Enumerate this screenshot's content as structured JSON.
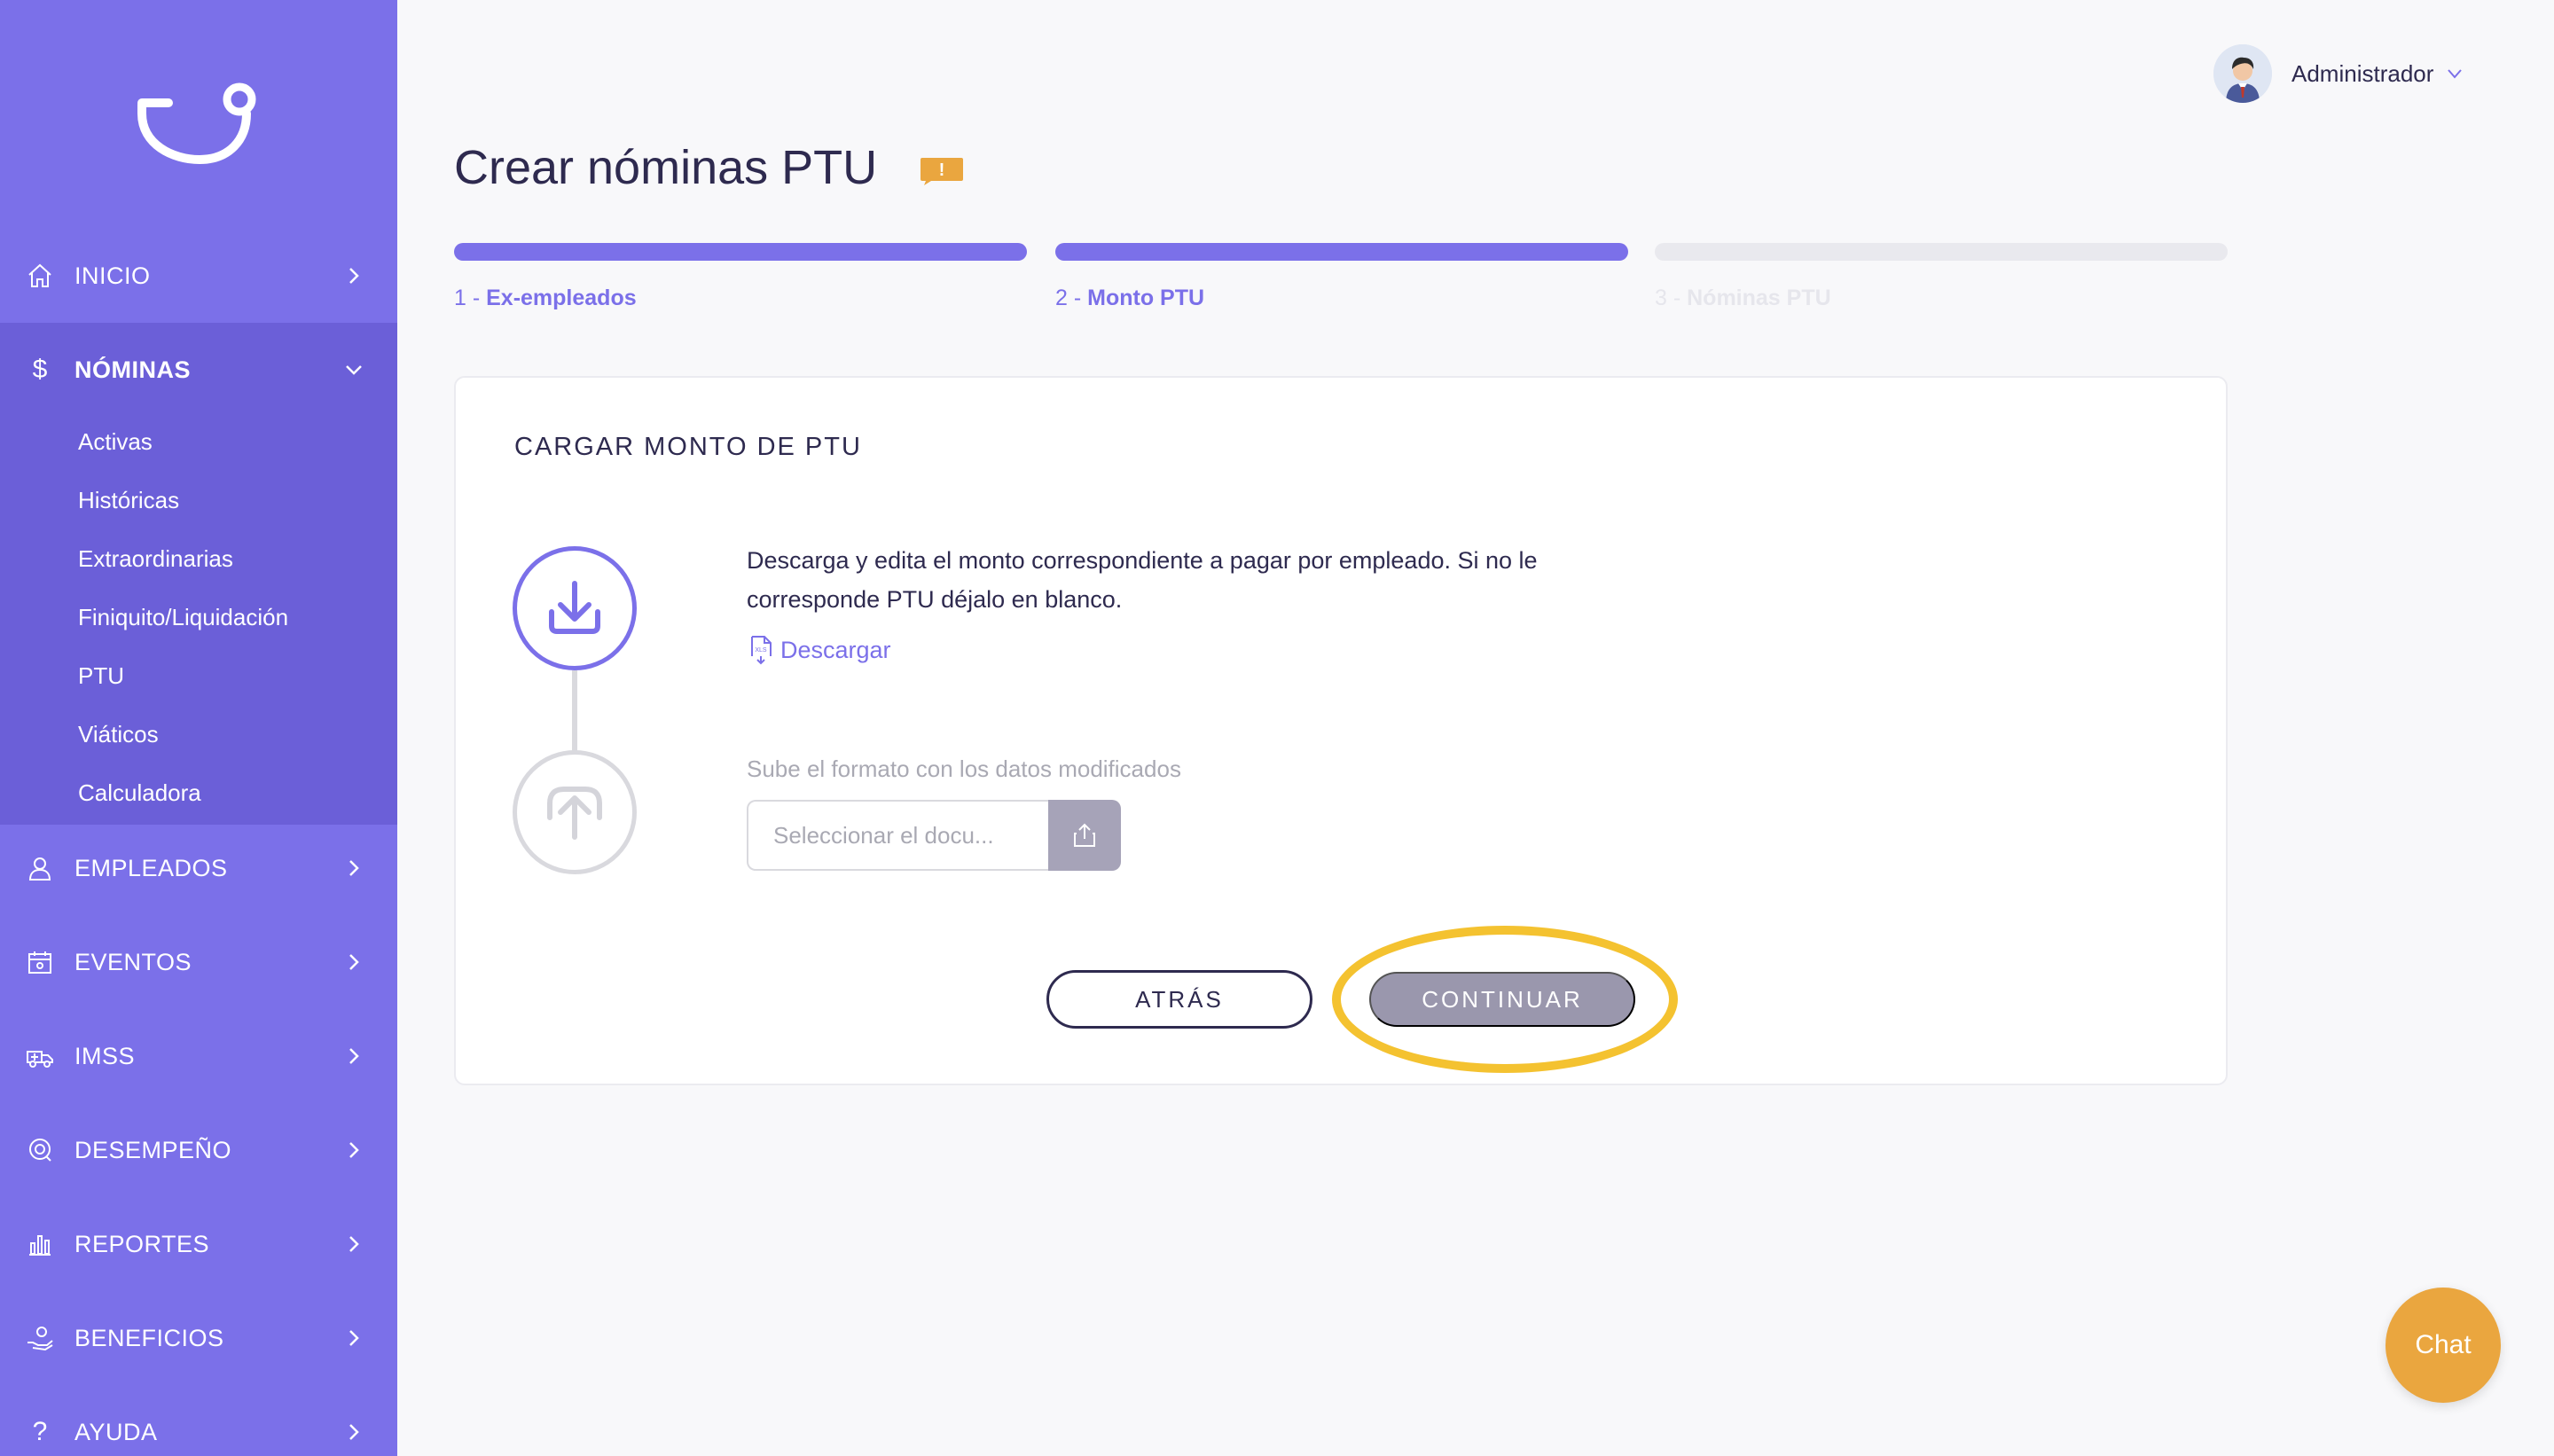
{
  "sidebar": {
    "items": [
      {
        "label": "INICIO",
        "icon": "home-icon"
      },
      {
        "label": "NÓMINAS",
        "icon": "dollar-icon"
      },
      {
        "label": "EMPLEADOS",
        "icon": "user-icon"
      },
      {
        "label": "EVENTOS",
        "icon": "calendar-icon"
      },
      {
        "label": "IMSS",
        "icon": "ambulance-icon"
      },
      {
        "label": "DESEMPEÑO",
        "icon": "target-icon"
      },
      {
        "label": "REPORTES",
        "icon": "bar-chart-icon"
      },
      {
        "label": "BENEFICIOS",
        "icon": "hand-coin-icon"
      },
      {
        "label": "AYUDA",
        "icon": "question-icon"
      }
    ],
    "submenu": [
      "Activas",
      "Históricas",
      "Extraordinarias",
      "Finiquito/Liquidación",
      "PTU",
      "Viáticos",
      "Calculadora"
    ]
  },
  "header": {
    "user_name": "Administrador"
  },
  "page": {
    "title": "Crear nóminas PTU",
    "warning_badge": "!"
  },
  "steps": [
    {
      "num": "1 - ",
      "label": "Ex-empleados",
      "state": "complete"
    },
    {
      "num": "2 - ",
      "label": "Monto PTU",
      "state": "active"
    },
    {
      "num": "3 - ",
      "label": "Nóminas PTU",
      "state": "pending"
    }
  ],
  "card": {
    "title": "CARGAR MONTO DE PTU",
    "description": "Descarga y edita el monto correspondiente a pagar por empleado. Si no le corresponde PTU déjalo en blanco.",
    "download_link": "Descargar",
    "upload_label": "Sube el formato con los datos modificados",
    "file_placeholder": "Seleccionar el docu...",
    "back_button": "ATRÁS",
    "continue_button": "CONTINUAR"
  },
  "chat": {
    "label": "Chat"
  },
  "colors": {
    "sidebar": "#7b70e9",
    "sidebar_active": "#6b5fd8",
    "accent": "#7b70e9",
    "step_pending": "#e9e9ee",
    "highlight": "#f4c230",
    "chat": "#eaa63f",
    "warning": "#eaa63f"
  }
}
